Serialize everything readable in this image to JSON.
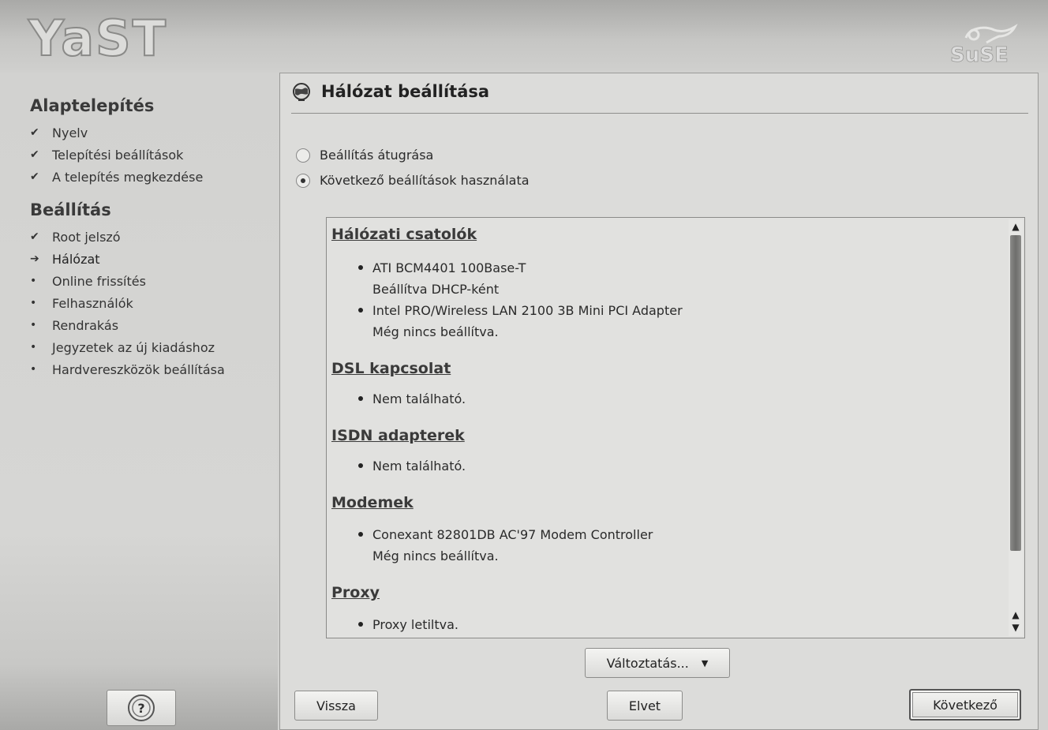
{
  "header": {
    "app_logo": "YaST",
    "brand_logo": "SuSE",
    "brand_icon": "chameleon-icon"
  },
  "sidebar": {
    "sections": [
      {
        "title": "Alaptelepítés",
        "items": [
          {
            "label": "Nyelv",
            "state": "done"
          },
          {
            "label": "Telepítési beállítások",
            "state": "done"
          },
          {
            "label": "A telepítés megkezdése",
            "state": "done"
          }
        ]
      },
      {
        "title": "Beállítás",
        "items": [
          {
            "label": "Root jelszó",
            "state": "done"
          },
          {
            "label": "Hálózat",
            "state": "current"
          },
          {
            "label": "Online frissítés",
            "state": "pending"
          },
          {
            "label": "Felhasználók",
            "state": "pending"
          },
          {
            "label": "Rendrakás",
            "state": "pending"
          },
          {
            "label": "Jegyzetek az új kiadáshoz",
            "state": "pending"
          },
          {
            "label": "Hardvereszközök beállítása",
            "state": "pending"
          }
        ]
      }
    ],
    "help_icon": "help-icon"
  },
  "main": {
    "title": "Hálózat beállítása",
    "title_icon": "network-globe-icon",
    "options": [
      {
        "label": "Beállítás átugrása",
        "selected": false
      },
      {
        "label": "Következő beállítások használata",
        "selected": true
      }
    ],
    "summary": [
      {
        "heading": "Hálózati csatolók",
        "entries": [
          {
            "name": "ATI BCM4401 100Base-T",
            "status": "Beállítva DHCP-ként"
          },
          {
            "name": "Intel PRO/Wireless LAN 2100 3B Mini PCI Adapter",
            "status": "Még nincs beállítva."
          }
        ]
      },
      {
        "heading": "DSL kapcsolat",
        "entries": [
          {
            "name": "Nem található.",
            "status": ""
          }
        ]
      },
      {
        "heading": "ISDN adapterek",
        "entries": [
          {
            "name": "Nem található.",
            "status": ""
          }
        ]
      },
      {
        "heading": "Modemek",
        "entries": [
          {
            "name": "Conexant 82801DB AC'97 Modem Controller",
            "status": "Még nincs beállítva."
          }
        ]
      },
      {
        "heading": "Proxy",
        "entries": [
          {
            "name": "Proxy letiltva.",
            "status": ""
          }
        ]
      }
    ],
    "change_button": "Változtatás...",
    "back_button": "Vissza",
    "abort_button": "Elvet",
    "next_button": "Következő"
  }
}
